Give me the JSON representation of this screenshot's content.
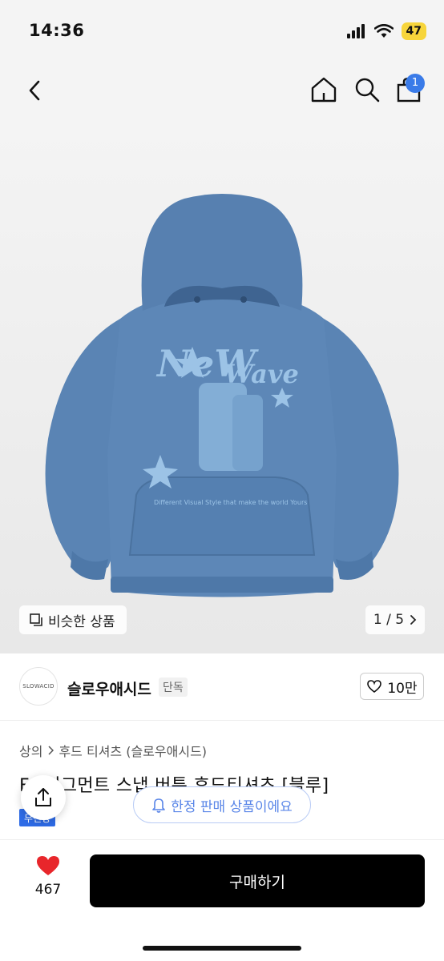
{
  "status_bar": {
    "time": "14:36",
    "battery": "47"
  },
  "nav": {
    "cart_count": "1"
  },
  "image": {
    "similar_label": "비슷한 상품",
    "page_counter": "1 / 5"
  },
  "brand": {
    "logo_text": "SLOWACID",
    "name": "슬로우애시드",
    "tag": "단독",
    "likes": "10만"
  },
  "breadcrumb": {
    "level1": "상의",
    "level2": "후드 티셔츠 (슬로우애시드)"
  },
  "product": {
    "title": "F.. 피그먼트 스냅 버튼 후드티셔츠 [블루]",
    "delivery_tag": "무신당"
  },
  "limited_banner": "한정 판매 상품이에요",
  "bottom": {
    "wish_count": "467",
    "buy_label": "구매하기"
  },
  "colors": {
    "accent": "#3a7be8",
    "hoodie": "#5a84b4",
    "limited": "#5a86e8"
  },
  "hoodie_print": {
    "text_top": "NeW",
    "text_wave": "Wave",
    "slogan": "Different Visual Style that make the world Yours"
  }
}
